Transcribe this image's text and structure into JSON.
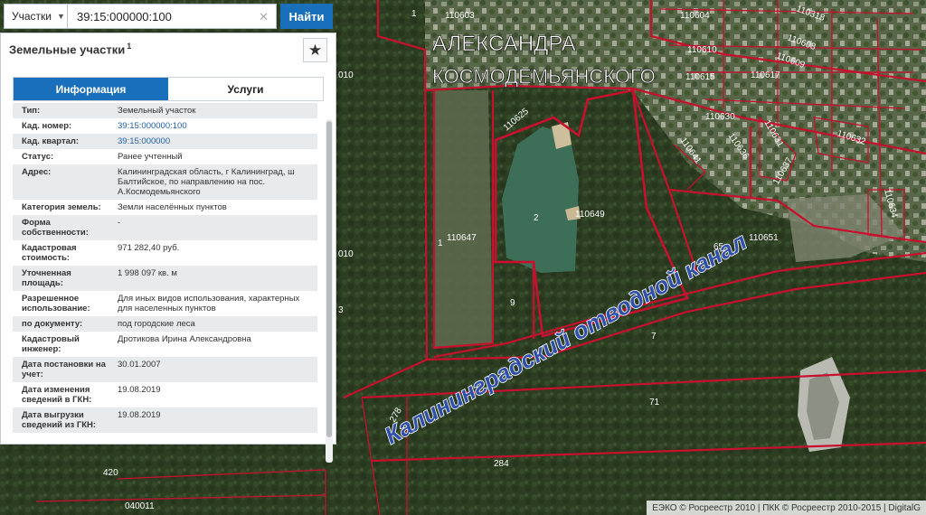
{
  "search": {
    "scope": "Участки",
    "query": "39:15:000000:100",
    "find_label": "Найти"
  },
  "panel": {
    "title": "Земельные участки",
    "title_sup": "1",
    "tabs": [
      {
        "label": "Информация",
        "active": true
      },
      {
        "label": "Услуги",
        "active": false
      }
    ],
    "rows": [
      {
        "key": "Тип:",
        "value": "Земельный участок"
      },
      {
        "key": "Кад. номер:",
        "value": "39:15:000000:100"
      },
      {
        "key": "Кад. квартал:",
        "value": "39:15:000000"
      },
      {
        "key": "Статус:",
        "value": "Ранее учтенный"
      },
      {
        "key": "Адрес:",
        "value": "Калининградская область, г Калининград, ш Балтийское, по направлению на пос. А.Космодемьянского"
      },
      {
        "key": "Категория земель:",
        "value": "Земли населённых пунктов"
      },
      {
        "key": "Форма собственности:",
        "value": "-"
      },
      {
        "key": "Кадастровая стоимость:",
        "value": "971 282,40 руб."
      },
      {
        "key": "Уточненная площадь:",
        "value": "1 998 097 кв. м"
      },
      {
        "key": "Разрешенное использование:",
        "value": "Для иных видов использования, характерных для населенных пунктов"
      },
      {
        "key": "по документу:",
        "value": "под городские леса"
      },
      {
        "key": "Кадастровый инженер:",
        "value": "Дротикова Ирина Александровна"
      },
      {
        "key": "Дата постановки на учет:",
        "value": "30.01.2007"
      },
      {
        "key": "Дата изменения сведений в ГКН:",
        "value": "19.08.2019"
      },
      {
        "key": "Дата выгрузки сведений из ГКН:",
        "value": "19.08.2019"
      }
    ]
  },
  "map": {
    "district_label_1": "АЛЕКСАНДРА",
    "district_label_2": "КОСМОДЕМЬЯНСКОГО",
    "canal_label": "Калининградский отводной канал",
    "parcel_labels": [
      "110603",
      "110604",
      "110318",
      "110608",
      "110610",
      "110609",
      "110615",
      "110617",
      "110630",
      "110631",
      "110632",
      "110641",
      "110636",
      "110637",
      "110625",
      "110649",
      "110647",
      "110651",
      "110634",
      "010",
      "010",
      "420",
      "040011",
      "278",
      "284",
      "71",
      "65",
      "9",
      "7",
      "2",
      "1",
      "1",
      "3"
    ],
    "attribution": "ЕЭКО © Росреестр 2010 | ПКК © Росреестр 2010-2015 | DigitalG"
  },
  "colors": {
    "accent": "#1a6fba",
    "parcel_border": "#c8102e",
    "link": "#1f5fa8"
  }
}
